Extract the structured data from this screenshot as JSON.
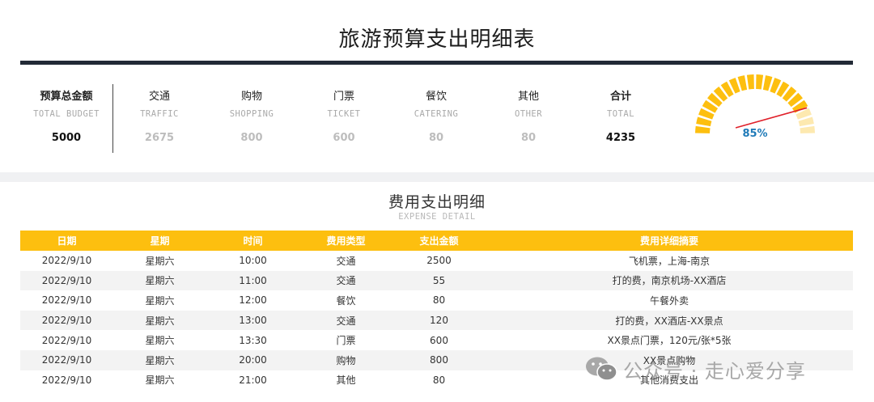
{
  "title": "旅游预算支出明细表",
  "kpis": [
    {
      "cn": "预算总金额",
      "en": "TOTAL BUDGET",
      "value": "5000"
    },
    {
      "cn": "交通",
      "en": "TRAFFIC",
      "value": "2675"
    },
    {
      "cn": "购物",
      "en": "SHOPPING",
      "value": "800"
    },
    {
      "cn": "门票",
      "en": "TICKET",
      "value": "600"
    },
    {
      "cn": "餐饮",
      "en": "CATERING",
      "value": "80"
    },
    {
      "cn": "其他",
      "en": "OTHER",
      "value": "80"
    },
    {
      "cn": "合计",
      "en": "TOTAL",
      "value": "4235"
    }
  ],
  "gauge": {
    "label": "85%",
    "fraction": 0.85,
    "fill_color": "#fdbf0f",
    "empty_color": "#fde9b0",
    "needle_color": "#e0202a"
  },
  "detail": {
    "title": "费用支出明细",
    "subtitle": "EXPENSE DETAIL",
    "columns": [
      "日期",
      "星期",
      "时间",
      "费用类型",
      "支出金额",
      "费用详细摘要"
    ],
    "rows": [
      [
        "2022/9/10",
        "星期六",
        "10:00",
        "交通",
        "2500",
        "飞机票，上海-南京"
      ],
      [
        "2022/9/10",
        "星期六",
        "11:00",
        "交通",
        "55",
        "打的费，南京机场-XX酒店"
      ],
      [
        "2022/9/10",
        "星期六",
        "12:00",
        "餐饮",
        "80",
        "午餐外卖"
      ],
      [
        "2022/9/10",
        "星期六",
        "13:00",
        "交通",
        "120",
        "打的费，XX酒店-XX景点"
      ],
      [
        "2022/9/10",
        "星期六",
        "13:30",
        "门票",
        "600",
        "XX景点门票，120元/张*5张"
      ],
      [
        "2022/9/10",
        "星期六",
        "20:00",
        "购物",
        "800",
        "XX景点购物"
      ],
      [
        "2022/9/10",
        "星期六",
        "21:00",
        "其他",
        "80",
        "其他消费支出"
      ]
    ]
  },
  "watermark": {
    "text": "公众号 · 走心爱分享",
    "icon": "wechat-icon"
  }
}
